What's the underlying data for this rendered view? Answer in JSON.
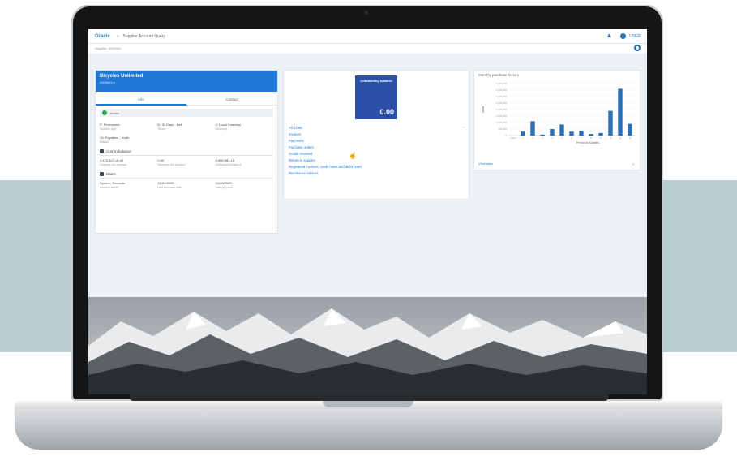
{
  "app": {
    "logo": "Oracle",
    "breadcrumb_sep": "»",
    "title": "Supplier Account Query",
    "filter_text": "Supplier: 0000001",
    "user_label": "USER"
  },
  "supplier": {
    "name": "Bicycles Unlimited",
    "code": "0000001 ▾",
    "tabs": [
      "Info",
      "Contact"
    ],
    "status": "Active",
    "info": [
      {
        "value": "P: Permanent",
        "label": "Supplier type"
      },
      {
        "value": "D: 30 Days - Net",
        "label": "Terms"
      },
      {
        "value": "$: Local Currency",
        "label": "Currency"
      }
    ],
    "extra": {
      "value": "10: Payables - North",
      "label": "Branch"
    },
    "currentbalance": {
      "title": "Currentbalance",
      "items": [
        {
          "value": "4,473,807.15 40",
          "label": "Ordered not received"
        },
        {
          "value": "0.00",
          "label": "Received not invoiced"
        },
        {
          "value": "5,555,965.15",
          "label": "Outstanding balance"
        }
      ]
    },
    "dates": {
      "title": "Dates",
      "items": [
        {
          "value": "System, Seconds",
          "label": "Account added"
        },
        {
          "value": "31/03/2020",
          "label": "Last purchase date"
        },
        {
          "value": "01/03/2020",
          "label": "Last payment"
        }
      ]
    }
  },
  "middle": {
    "tile_label": "Outstanding balance",
    "tile_value": "0.00",
    "links_header": "All: Links",
    "links": [
      "Invoices",
      "Payments",
      "Purchase orders",
      "Goods received",
      "Return to supplier",
      "Registered invoices, credit notes and debit notes",
      "Remittance advices"
    ]
  },
  "chart_panel": {
    "title": "Monthly purchase history",
    "view_data": "View data",
    "chart_data": {
      "type": "bar",
      "xlabel": "Previous Months",
      "ylabel": "Value",
      "categories": [
        "2019",
        "1",
        "2",
        "3",
        "4",
        "5",
        "6",
        "7",
        "8",
        "9",
        "10",
        "11",
        "12"
      ],
      "values": [
        0,
        300000,
        1100000,
        80000,
        500000,
        850000,
        300000,
        380000,
        120000,
        200000,
        1900000,
        3600000,
        900000
      ],
      "ylim": [
        0,
        4000000
      ],
      "ytick_labels": [
        "4,000,000",
        "3,500,000",
        "3,000,000",
        "2,500,000",
        "2,000,000",
        "1,500,000",
        "1,000,000",
        "500,000",
        "0"
      ],
      "color": "#2a6fb5"
    }
  }
}
